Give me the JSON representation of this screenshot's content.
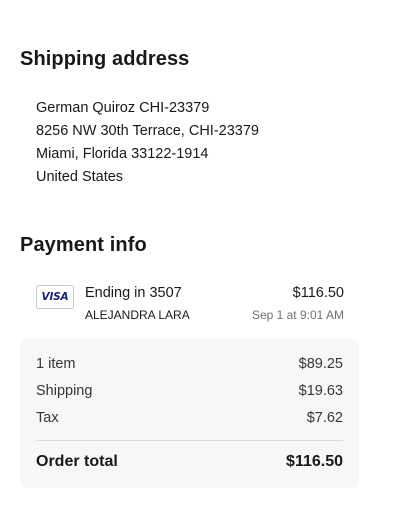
{
  "shipping": {
    "title": "Shipping address",
    "lines": [
      "German Quiroz CHI-23379",
      "8256 NW 30th Terrace, CHI-23379",
      "Miami, Florida 33122-1914",
      "United States"
    ]
  },
  "payment": {
    "title": "Payment info",
    "card_brand": "VISA",
    "card_icon": "visa-card-icon",
    "ending": "Ending in 3507",
    "holder": "ALEJANDRA LARA",
    "amount": "$116.50",
    "date": "Sep 1 at 9:01 AM"
  },
  "summary": {
    "items_label": "1 item",
    "items_value": "$89.25",
    "shipping_label": "Shipping",
    "shipping_value": "$19.63",
    "tax_label": "Tax",
    "tax_value": "$7.62",
    "total_label": "Order total",
    "total_value": "$116.50"
  }
}
